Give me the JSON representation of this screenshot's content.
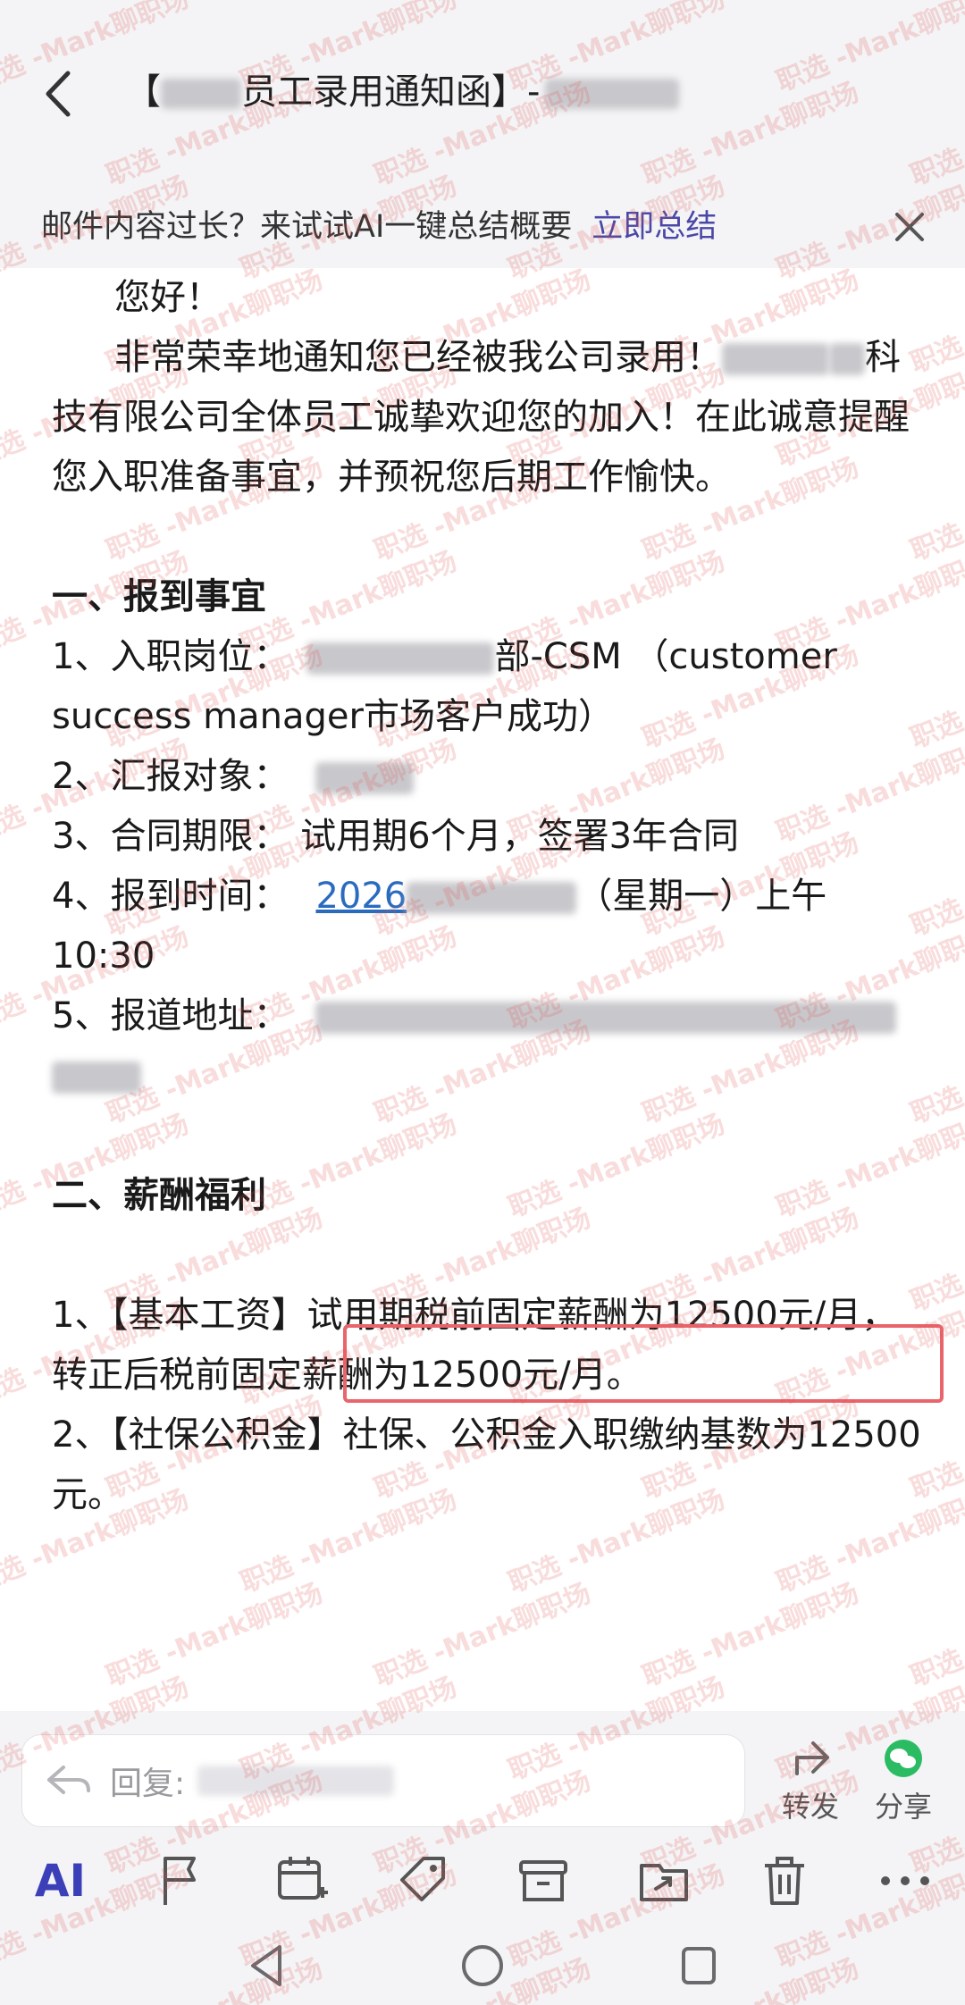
{
  "header": {
    "title_prefix": "【",
    "title_main": "员工录用通知函】-"
  },
  "ai_banner": {
    "text": "邮件内容过长？来试试AI一键总结概要",
    "link": "立即总结"
  },
  "body": {
    "greeting": "您好！",
    "para1_a": "非常荣幸地通知您已经被我公司录用！",
    "para1_b": "科技有限公司全体员工诚挚欢迎您的加入！在此诚意提醒您入职准备事宜，并预祝您后期工作愉快。",
    "section1": "一、报到事宜",
    "item1_label": "1、入职岗位：",
    "item1_value": "部-CSM （customer success manager市场客户成功）",
    "item2_label": "2、汇报对象：",
    "item3": "3、合同期限： 试用期6个月，签署3年合同",
    "item4_label": "4、报到时间：",
    "item4_date": "2026",
    "item4_rest": "（星期一）上午10:30",
    "item5_label": "5、报道地址：",
    "section2": "二、薪酬福利",
    "salary1": "1、【基本工资】试用期税前固定薪酬为12500元/月，转正后税前固定薪酬为12500元/月。",
    "salary2": "2、【社保公积金】社保、公积金入职缴纳基数为12500元。"
  },
  "reply": {
    "placeholder": "回复:",
    "forward": "转发",
    "share": "分享"
  },
  "toolbar": {
    "ai": "AI"
  },
  "watermark": {
    "text": "职选 -Mark聊职场"
  },
  "colors": {
    "accent": "#4a48a6",
    "highlight": "#e8656b",
    "link": "#2a6bbf"
  }
}
